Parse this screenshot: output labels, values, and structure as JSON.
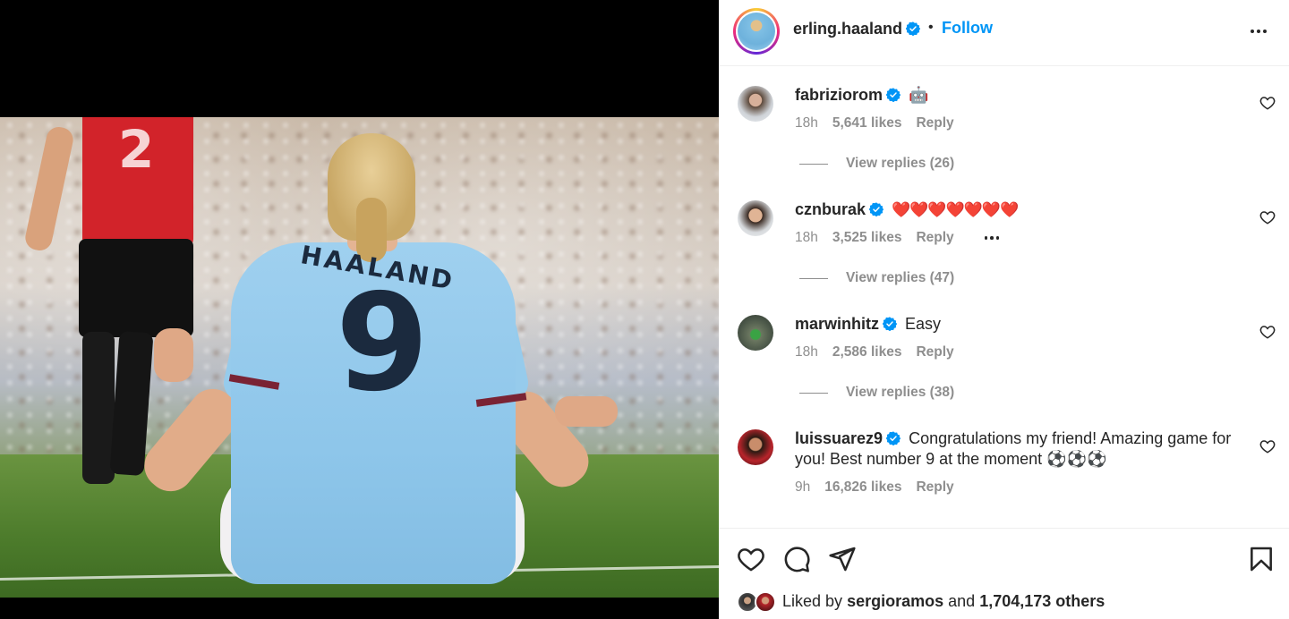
{
  "post": {
    "owner": {
      "username": "erling.haaland",
      "verified": true
    },
    "separator": "•",
    "follow_label": "Follow",
    "media": {
      "shirt_name": "HAALAND",
      "shirt_number": "9",
      "opponent_number": "2"
    }
  },
  "comments": [
    {
      "username": "fabriziorom",
      "verified": true,
      "text": "🤖",
      "time": "18h",
      "likes": "5,641 likes",
      "reply_label": "Reply",
      "view_replies": "View replies (26)",
      "show_more": false
    },
    {
      "username": "cznburak",
      "verified": true,
      "text": "❤️❤️❤️❤️❤️❤️❤️",
      "time": "18h",
      "likes": "3,525 likes",
      "reply_label": "Reply",
      "view_replies": "View replies (47)",
      "show_more": true
    },
    {
      "username": "marwinhitz",
      "verified": true,
      "text": "Easy",
      "time": "18h",
      "likes": "2,586 likes",
      "reply_label": "Reply",
      "view_replies": "View replies (38)",
      "show_more": false
    },
    {
      "username": "luissuarez9",
      "verified": true,
      "text": "Congratulations my friend! Amazing game for you! Best number 9 at the moment ⚽⚽⚽",
      "time": "9h",
      "likes": "16,826 likes",
      "reply_label": "Reply",
      "view_replies": "",
      "show_more": false
    }
  ],
  "likes": {
    "prefix": "Liked by",
    "user": "sergioramos",
    "middle": "and",
    "count": "1,704,173 others"
  },
  "icons": {
    "verified": "verified-badge-icon",
    "like": "heart-icon",
    "comment": "comment-icon",
    "share": "share-icon",
    "save": "bookmark-icon",
    "more": "more-options-icon"
  },
  "colors": {
    "accent": "#0095f6",
    "verified": "#0095f6",
    "heart": "#ed1d24",
    "muted": "#8e8e8e",
    "text": "#262626"
  }
}
